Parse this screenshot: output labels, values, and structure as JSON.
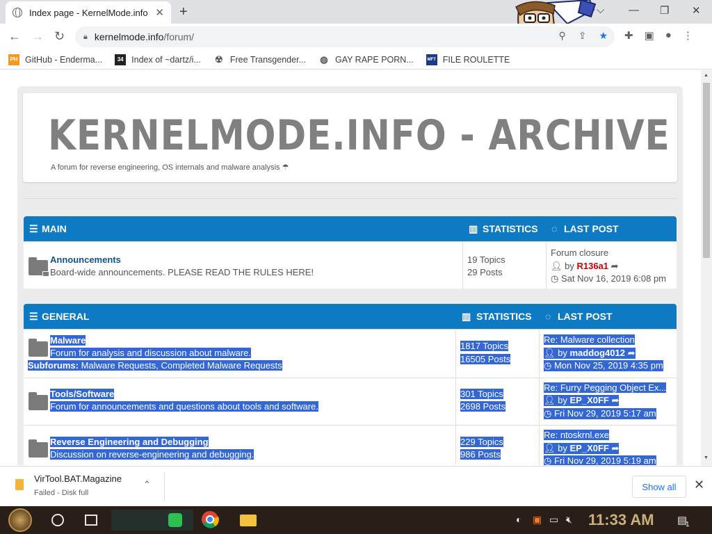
{
  "browser": {
    "tab_title": "Index page - KernelMode.info",
    "tab_close": "✕",
    "new_tab": "+",
    "url_host": "kernelmode.info",
    "url_path": "/forum/",
    "window_controls": {
      "minimize": "—",
      "maximize": "❐",
      "close": "✕",
      "dropdown": "⌵"
    },
    "bookmarks": [
      {
        "label": "GitHub - Enderma...",
        "icon": "PH",
        "color": "#f7971d"
      },
      {
        "label": "Index of ~dartz/i...",
        "icon": "34",
        "color": "#222222"
      },
      {
        "label": "Free Transgender...",
        "icon": "☢",
        "color": "#555555"
      },
      {
        "label": "GAY RAPE PORN...",
        "icon": "◍",
        "color": "#555555"
      },
      {
        "label": "FILE ROULETTE",
        "icon": "MFT",
        "color": "#1b3a8c"
      }
    ]
  },
  "site": {
    "title": "KERNELMODE.INFO - ARCHIVE",
    "description": "A forum for reverse engineering, OS internals and malware analysis ☂"
  },
  "sections": [
    {
      "name": "MAIN",
      "stats_header": "STATISTICS",
      "lastpost_header": "LAST POST",
      "forums": [
        {
          "name": "Announcements",
          "desc": "Board-wide announcements. PLEASE READ THE RULES HERE!",
          "topics": "19 Topics",
          "posts": "29 Posts",
          "lp_title": "Forum closure",
          "lp_by": "by",
          "lp_user": "R136a1",
          "lp_date": "Sat Nov 16, 2019 6:08 pm"
        }
      ]
    },
    {
      "name": "GENERAL",
      "stats_header": "STATISTICS",
      "lastpost_header": "LAST POST",
      "forums": [
        {
          "name": "Malware",
          "desc": "Forum for analysis and discussion about malware.",
          "subforums_label": "Subforums:",
          "subforums": "Malware Requests, Completed Malware Requests",
          "topics": "1817 Topics",
          "posts": "16505 Posts",
          "lp_title": "Re: Malware collection",
          "lp_by": "by",
          "lp_user": "maddog4012",
          "lp_date": "Mon Nov 25, 2019 4:35 pm"
        },
        {
          "name": "Tools/Software",
          "desc": "Forum for announcements and questions about tools and software.",
          "topics": "301 Topics",
          "posts": "2698 Posts",
          "lp_title": "Re: Furry Pegging Object Ex...",
          "lp_by": "by",
          "lp_user": "EP_X0FF",
          "lp_date": "Fri Nov 29, 2019 5:17 am"
        },
        {
          "name": "Reverse Engineering and Debugging",
          "desc": "Discussion on reverse-engineering and debugging.",
          "topics": "229 Topics",
          "posts": "986 Posts",
          "lp_title": "Re: ntoskrnl.exe",
          "lp_by": "by",
          "lp_user": "EP_X0FF",
          "lp_date": "Fri Nov 29, 2019 5:19 am"
        }
      ]
    }
  ],
  "download": {
    "file_name": "VirTool.BAT.Magazine",
    "status": "Failed - Disk full",
    "show_all": "Show all",
    "close": "✕"
  },
  "taskbar": {
    "time": "11:33 AM",
    "notification_count": "1"
  }
}
